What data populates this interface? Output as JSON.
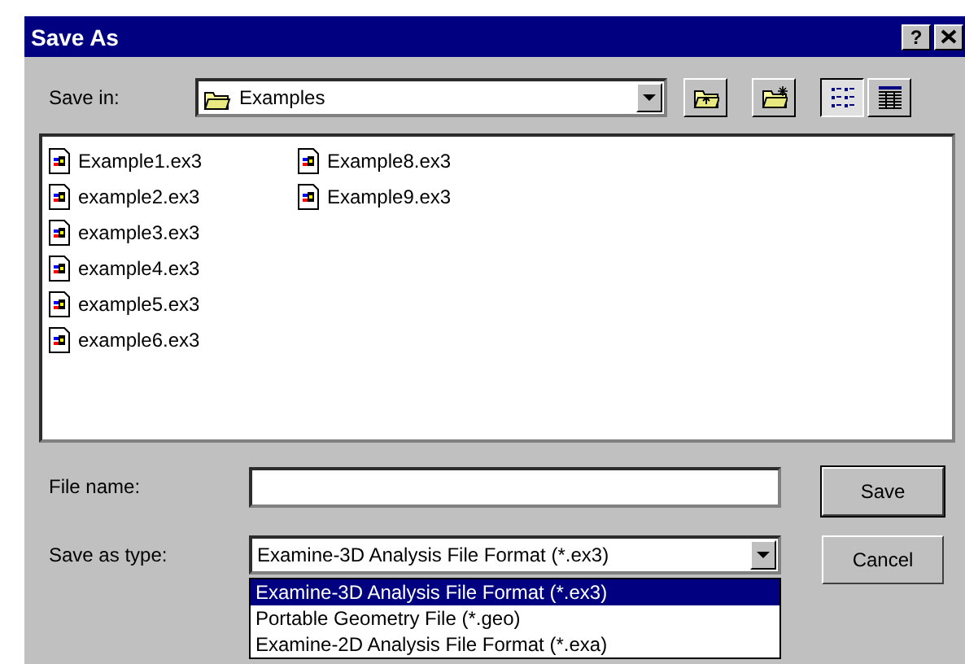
{
  "window": {
    "title": "Save As"
  },
  "title_buttons": [
    {
      "kind": "help",
      "label": "?"
    },
    {
      "kind": "close"
    }
  ],
  "save_in": {
    "label": "Save in:",
    "value": "Examples"
  },
  "toolbar": [
    {
      "kind": "up"
    },
    {
      "kind": "new_folder"
    },
    {
      "kind": "list",
      "selected": true
    },
    {
      "kind": "details",
      "selected": false
    }
  ],
  "files": [
    {
      "name": "Example1.ex3"
    },
    {
      "name": "example2.ex3"
    },
    {
      "name": "example3.ex3"
    },
    {
      "name": "example4.ex3"
    },
    {
      "name": "example5.ex3"
    },
    {
      "name": "example6.ex3"
    },
    {
      "name": "Example8.ex3"
    },
    {
      "name": "Example9.ex3"
    }
  ],
  "file_name": {
    "label": "File name:"
  },
  "save_as_type": {
    "label": "Save as type:",
    "value": "Examine-3D Analysis File Format (*.ex3)",
    "options": [
      {
        "label": "Examine-3D Analysis File Format (*.ex3)",
        "selected": true
      },
      {
        "label": "Portable Geometry File (*.geo)",
        "selected": false
      },
      {
        "label": "Examine-2D Analysis File Format (*.exa)",
        "selected": false
      }
    ]
  },
  "buttons": [
    {
      "label": "Save",
      "default": true
    },
    {
      "label": "Cancel",
      "default": false
    }
  ]
}
